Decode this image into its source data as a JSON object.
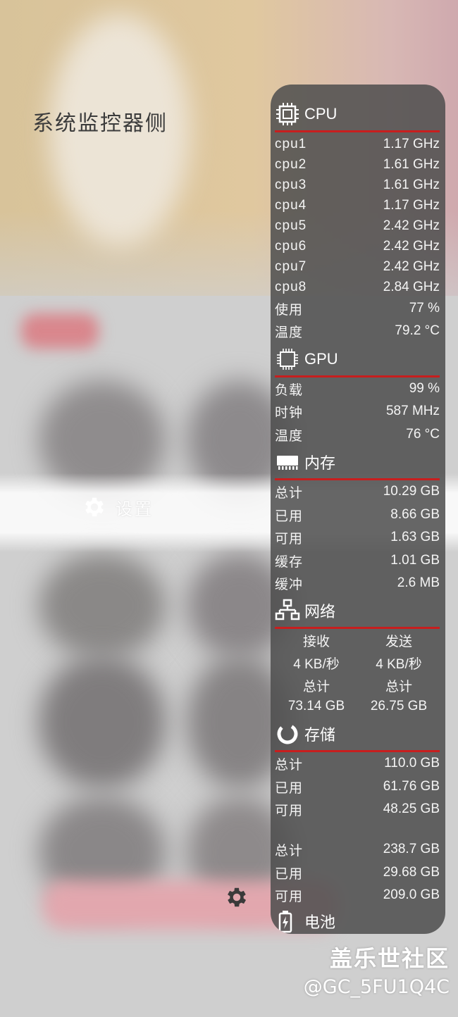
{
  "app_title": "系统监控器侧",
  "settings_label": "设置",
  "cpu": {
    "title": "CPU",
    "rows": [
      {
        "label": "cpu1",
        "value": "1.17 GHz"
      },
      {
        "label": "cpu2",
        "value": "1.61 GHz"
      },
      {
        "label": "cpu3",
        "value": "1.61 GHz"
      },
      {
        "label": "cpu4",
        "value": "1.17 GHz"
      },
      {
        "label": "cpu5",
        "value": "2.42 GHz"
      },
      {
        "label": "cpu6",
        "value": "2.42 GHz"
      },
      {
        "label": "cpu7",
        "value": "2.42 GHz"
      },
      {
        "label": "cpu8",
        "value": "2.84 GHz"
      },
      {
        "label": "使用",
        "value": "77 %"
      },
      {
        "label": "温度",
        "value": "79.2 °C"
      }
    ]
  },
  "gpu": {
    "title": "GPU",
    "rows": [
      {
        "label": "负载",
        "value": "99 %"
      },
      {
        "label": "时钟",
        "value": "587 MHz"
      },
      {
        "label": "温度",
        "value": "76 °C"
      }
    ]
  },
  "memory": {
    "title": "内存",
    "rows": [
      {
        "label": "总计",
        "value": "10.29 GB"
      },
      {
        "label": "已用",
        "value": "8.66 GB"
      },
      {
        "label": "可用",
        "value": "1.63 GB"
      },
      {
        "label": "缓存",
        "value": "1.01 GB"
      },
      {
        "label": "缓冲",
        "value": "2.6 MB"
      }
    ]
  },
  "network": {
    "title": "网络",
    "receive_label": "接收",
    "send_label": "发送",
    "receive_rate": "4 KB/秒",
    "send_rate": "4 KB/秒",
    "receive_total_label": "总计",
    "send_total_label": "总计",
    "receive_total": "73.14 GB",
    "send_total": "26.75 GB"
  },
  "storage": {
    "title": "存储",
    "internal": [
      {
        "label": "总计",
        "value": "110.0 GB"
      },
      {
        "label": "已用",
        "value": "61.76 GB"
      },
      {
        "label": "可用",
        "value": "48.25 GB"
      }
    ],
    "external": [
      {
        "label": "总计",
        "value": "238.7 GB"
      },
      {
        "label": "已用",
        "value": "29.68 GB"
      },
      {
        "label": "可用",
        "value": "209.0 GB"
      }
    ]
  },
  "battery": {
    "title": "电池"
  },
  "watermark": {
    "line1": "盖乐世社区",
    "line2": "@GC_5FU1Q4C"
  },
  "colors": {
    "accent_divider": "#c81e1e",
    "panel_bg": "#4e4e4e"
  }
}
